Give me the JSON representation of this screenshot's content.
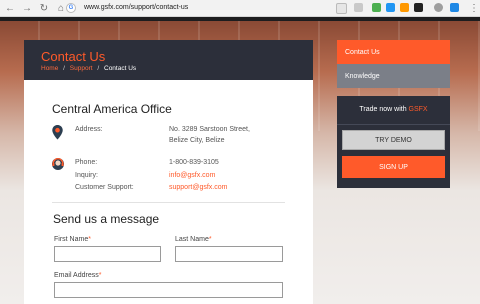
{
  "browser": {
    "url": "www.gsfx.com/support/contact-us",
    "favicon_letter": "G"
  },
  "header": {
    "title": "Contact Us",
    "breadcrumb": [
      "Home",
      "Support",
      "Contact Us"
    ],
    "breadcrumb_sep": "/"
  },
  "office": {
    "title": "Central America Office",
    "address_label": "Address:",
    "address_line1": "No. 3289 Sarstoon Street,",
    "address_line2": "Belize City, Belize",
    "phone_label": "Phone:",
    "phone_value": "1-800-839-3105",
    "inquiry_label": "Inquiry:",
    "inquiry_value": "info@gsfx.com",
    "support_label": "Customer Support:",
    "support_value": "support@gsfx.com"
  },
  "form": {
    "title": "Send us a message",
    "first_name_label": "First Name",
    "last_name_label": "Last Name",
    "email_label": "Email Address",
    "required_mark": "*"
  },
  "sidebar": {
    "items": [
      "Contact Us",
      "Knowledge"
    ],
    "trade_prefix": "Trade now with",
    "trade_brand": "GSFX",
    "demo_button": "TRY DEMO",
    "signup_button": "SIGN UP"
  },
  "colors": {
    "accent": "#ff5a2a",
    "dark_panel": "#2c2f3a",
    "knowledge_bg": "#7b7f88"
  }
}
